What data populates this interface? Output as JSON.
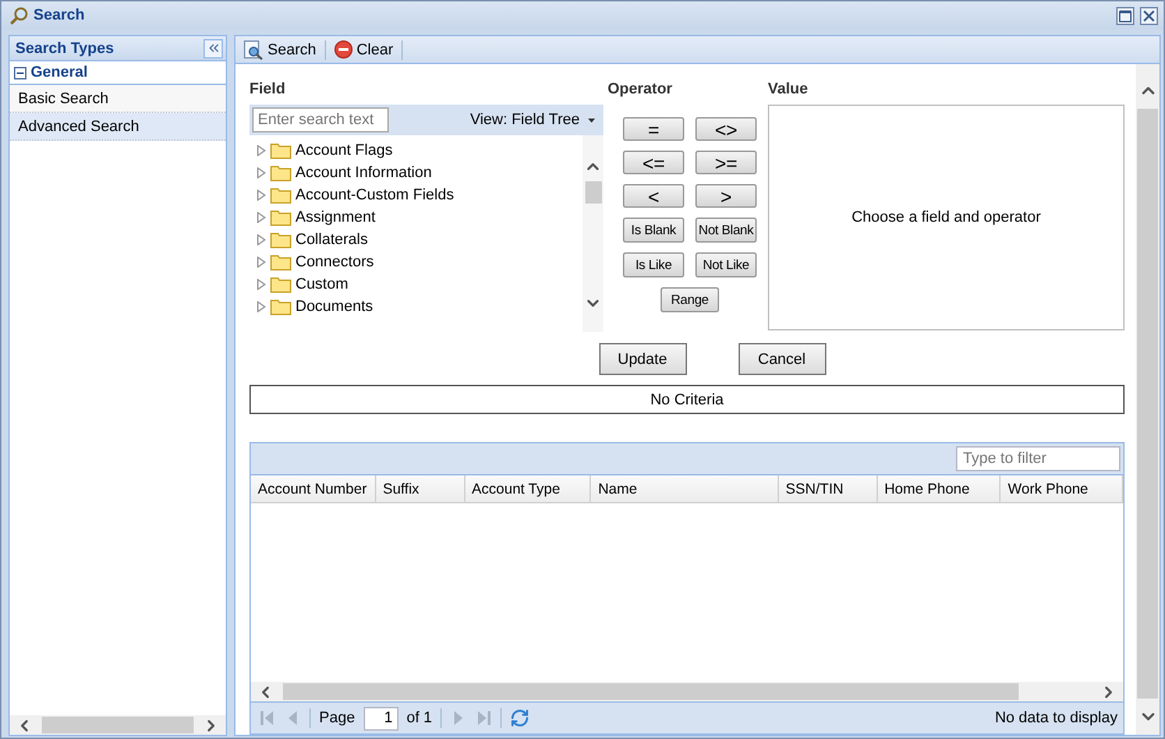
{
  "window": {
    "title": "Search"
  },
  "sidebar": {
    "title": "Search Types",
    "groups": [
      {
        "label": "General",
        "expanded": true,
        "items": [
          {
            "label": "Basic Search",
            "selected": false
          },
          {
            "label": "Advanced Search",
            "selected": true
          }
        ]
      }
    ]
  },
  "toolbar": [
    {
      "label": "Search",
      "kind": "search"
    },
    {
      "label": "Clear",
      "kind": "clear"
    }
  ],
  "field": {
    "label": "Field",
    "placeholder": "Enter search text",
    "view": "View: Field Tree",
    "tree": [
      {
        "label": "Account Flags",
        "expanded": false
      },
      {
        "label": "Account Information",
        "expanded": false
      },
      {
        "label": "Account-Custom Fields",
        "expanded": false
      },
      {
        "label": "Assignment",
        "expanded": false
      },
      {
        "label": "Collaterals",
        "expanded": false
      },
      {
        "label": "Connectors",
        "expanded": false
      },
      {
        "label": "Custom",
        "expanded": false
      },
      {
        "label": "Documents",
        "expanded": false
      }
    ]
  },
  "operator": {
    "label": "Operator",
    "buttons": [
      {
        "label": "=",
        "kind": "symbol"
      },
      {
        "label": "<>",
        "kind": "symbol"
      },
      {
        "label": "<=",
        "kind": "symbol"
      },
      {
        "label": ">=",
        "kind": "symbol"
      },
      {
        "label": "<",
        "kind": "symbol"
      },
      {
        "label": ">",
        "kind": "symbol"
      },
      {
        "label": "Is Blank",
        "kind": "word"
      },
      {
        "label": "Not Blank",
        "kind": "word"
      },
      {
        "label": "Is Like",
        "kind": "word"
      },
      {
        "label": "Not Like",
        "kind": "word"
      },
      {
        "label": "Range",
        "kind": "wide"
      }
    ]
  },
  "value": {
    "label": "Value",
    "message": "Choose a field and operator"
  },
  "actions": [
    "Update",
    "Cancel"
  ],
  "criteria": "No Criteria",
  "grid": {
    "filter_placeholder": "Type to filter",
    "columns": [
      "Account Number",
      "Suffix",
      "Account Type",
      "Name",
      "SSN/TIN",
      "Home Phone",
      "Work Phone"
    ],
    "paging": {
      "page_label": "Page",
      "page": "1",
      "of": "of 1",
      "status": "No data to display"
    }
  }
}
